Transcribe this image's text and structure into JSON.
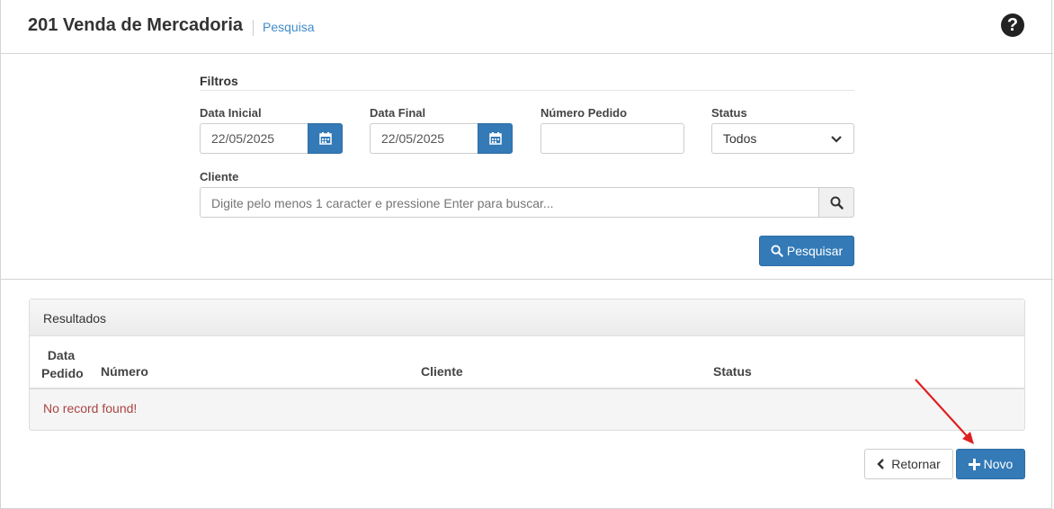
{
  "header": {
    "title": "201 Venda de Mercadoria",
    "breadcrumb": "Pesquisa",
    "help_icon": "question-circle-icon"
  },
  "filters": {
    "section_title": "Filtros",
    "data_inicial": {
      "label": "Data Inicial",
      "value": "22/05/2025",
      "icon": "calendar-icon"
    },
    "data_final": {
      "label": "Data Final",
      "value": "22/05/2025",
      "icon": "calendar-icon"
    },
    "numero_pedido": {
      "label": "Número Pedido",
      "value": ""
    },
    "status": {
      "label": "Status",
      "selected": "Todos"
    },
    "cliente": {
      "label": "Cliente",
      "placeholder": "Digite pelo menos 1 caracter e pressione Enter para buscar...",
      "icon": "search-icon"
    },
    "search_button": "Pesquisar"
  },
  "results": {
    "title": "Resultados",
    "columns": {
      "data_line1": "Data",
      "data_line2": "Pedido",
      "numero": "Número",
      "cliente": "Cliente",
      "status": "Status"
    },
    "empty_message": "No record found!"
  },
  "actions": {
    "back_label": "Retornar",
    "new_label": "Novo"
  },
  "colors": {
    "primary": "#337ab7",
    "error_text": "#a94442",
    "annotation_arrow": "#e02020"
  }
}
